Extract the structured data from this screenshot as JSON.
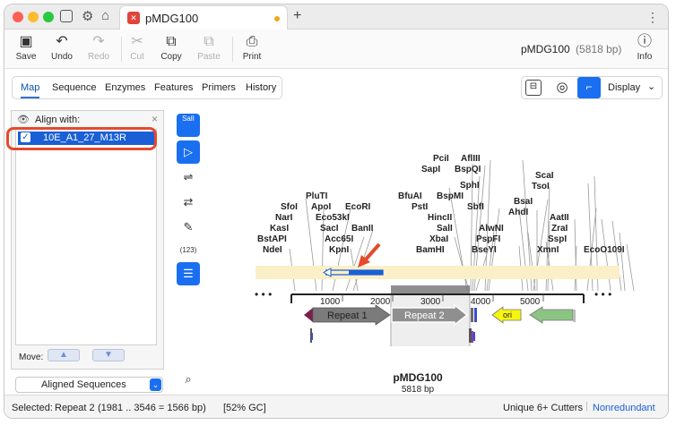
{
  "tab": {
    "title": "pMDG100",
    "add": "+",
    "more": "⋮"
  },
  "toolbar": {
    "save": "Save",
    "undo": "Undo",
    "redo": "Redo",
    "cut": "Cut",
    "copy": "Copy",
    "paste": "Paste",
    "print": "Print",
    "info": "Info",
    "file_name": "pMDG100",
    "file_size": "(5818 bp)"
  },
  "subtabs": [
    "Map",
    "Sequence",
    "Enzymes",
    "Features",
    "Primers",
    "History"
  ],
  "display_label": "Display",
  "align": {
    "title": "Align with:",
    "close": "×",
    "sequences": [
      "10E_A1_27_M13R"
    ],
    "move_label": "Move:",
    "select_value": "Aligned Sequences"
  },
  "vstrip": {
    "sali": "SalI",
    "count": "(123)"
  },
  "map": {
    "name": "pMDG100",
    "length": "5818 bp",
    "ticks": [
      "1000",
      "2000",
      "3000",
      "4000",
      "5000"
    ],
    "features": [
      "Repeat 1",
      "Repeat 2",
      "ori"
    ],
    "enzymes_left": [
      "BstAPI",
      "NdeI",
      "KasI",
      "NarI",
      "SfoI",
      "PluTI",
      "ApoI",
      "Eco53kI",
      "EcoRI",
      "SacI",
      "Acc65I",
      "KpnI",
      "BanII"
    ],
    "enzymes_mid": [
      "PciI",
      "SapI",
      "AflIII",
      "BspQI",
      "SphI",
      "BspMI",
      "SbfI",
      "PstI",
      "BfuAI",
      "HincII",
      "SalI",
      "XbaI",
      "BamHI",
      "AlwNI",
      "PspFI",
      "BseYI"
    ],
    "enzymes_right": [
      "ScaI",
      "TsoI",
      "BsaI",
      "AhdI",
      "AatII",
      "ZraI",
      "SspI",
      "XmnI",
      "EcoO109I"
    ],
    "ellipsis_left": "• • •",
    "ellipsis_right": "• • •"
  },
  "status": {
    "selected": "Selected:",
    "feature": "Repeat 2",
    "range": "(1981 .. 3546 = 1566 bp)",
    "gc": "[52% GC]",
    "cutters": "Unique 6+ Cutters",
    "mode": "Nonredundant"
  },
  "colors": {
    "accent": "#1a6ff0",
    "repeat1": "#7b7b7b",
    "repeat2": "#8f8f8f",
    "ori": "#f5f50f",
    "green_feature": "#8bc483",
    "highlight_ring": "#e54a2c",
    "alignment_track": "#fbefc7"
  }
}
